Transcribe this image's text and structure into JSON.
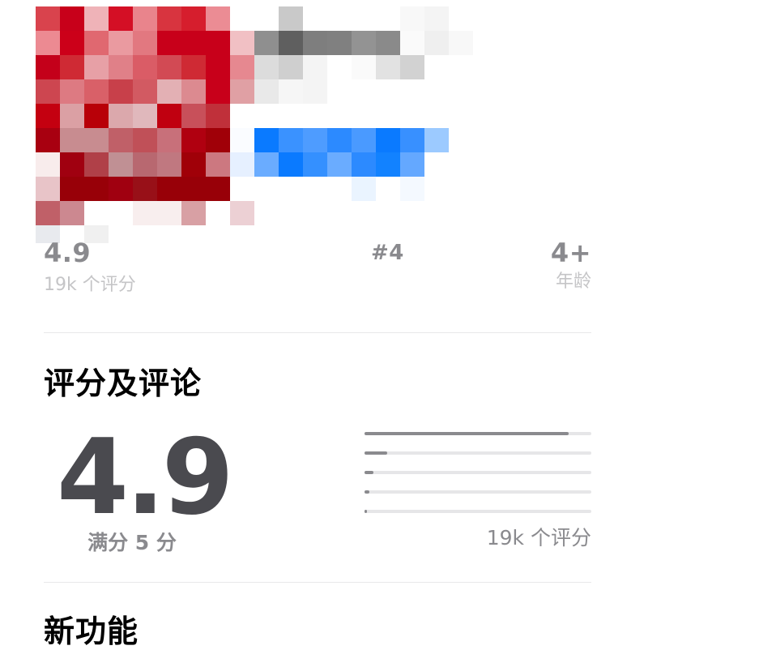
{
  "header": {
    "obscured_area": "pixelated-app-header"
  },
  "stats": {
    "rating_value": "4.9",
    "rating_label": "19k 个评分",
    "rank_value": "#4",
    "age_value": "4+",
    "age_label": "年龄"
  },
  "ratings_section": {
    "title": "评分及评论",
    "score": "4.9",
    "score_caption": "满分 5 分",
    "count_label": "19k 个评分",
    "distribution": [
      {
        "stars": 5,
        "fraction": 0.9
      },
      {
        "stars": 4,
        "fraction": 0.1
      },
      {
        "stars": 3,
        "fraction": 0.04
      },
      {
        "stars": 2,
        "fraction": 0.02
      },
      {
        "stars": 1,
        "fraction": 0.01
      }
    ]
  },
  "new_features": {
    "title": "新功能"
  },
  "colors": {
    "accent_blue": "#0a7aff",
    "brand_red": "#c8001a",
    "bar_fill": "#8a8a8e",
    "bar_track": "#e6e6e8"
  }
}
